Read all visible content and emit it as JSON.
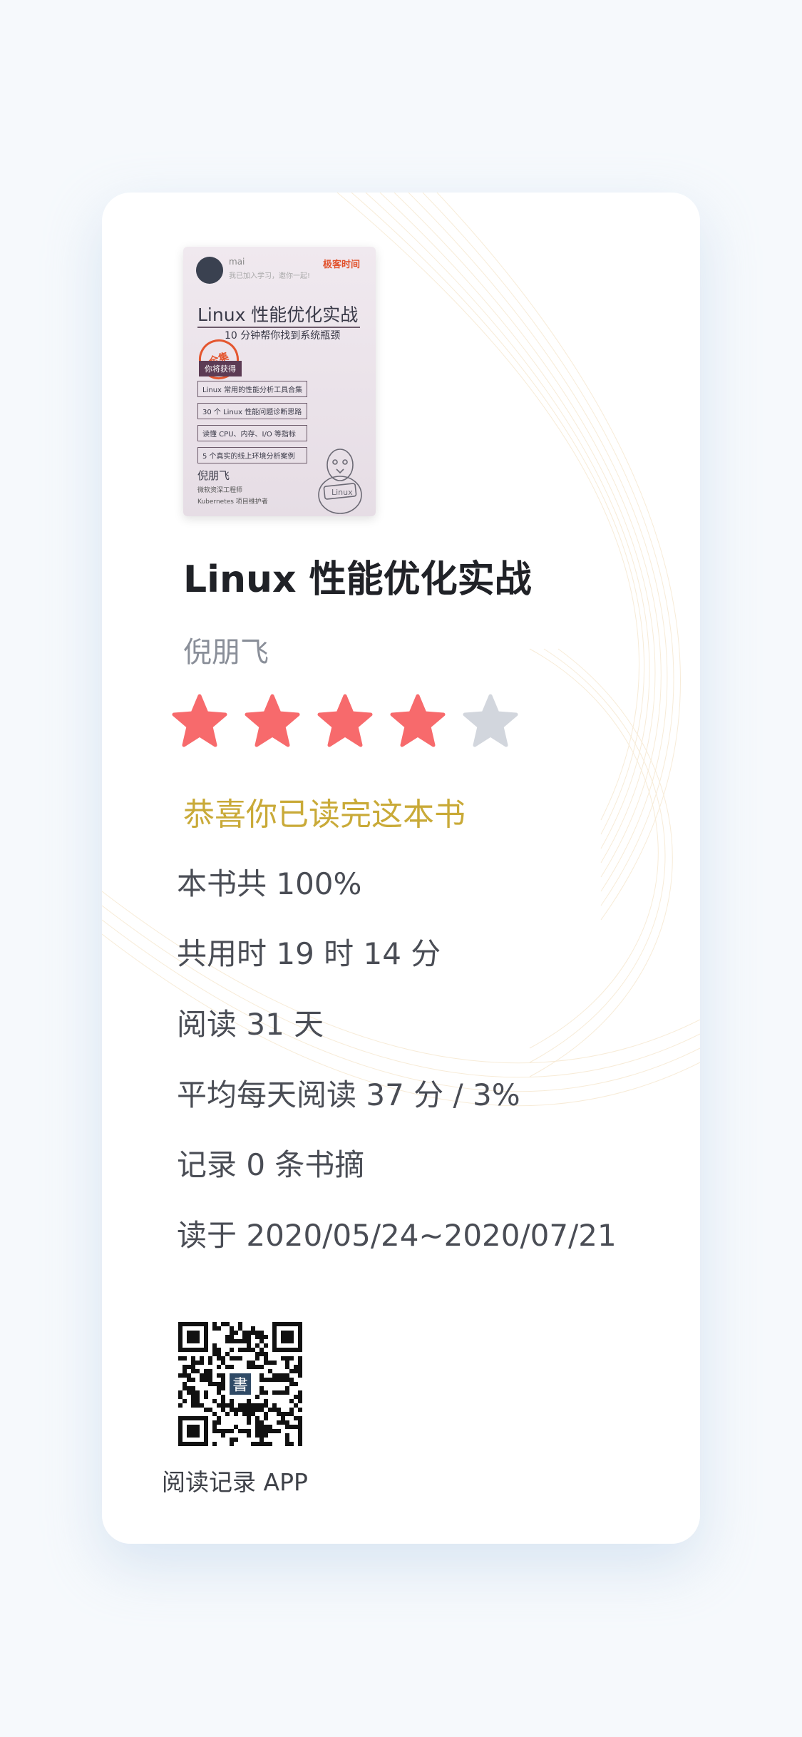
{
  "book": {
    "title": "Linux 性能优化实战",
    "author": "倪朋飞",
    "rating": 4,
    "rating_max": 5
  },
  "cover": {
    "user": "mai",
    "join_text": "我已加入学习，邀你一起!",
    "brand": "极客时间",
    "title": "Linux 性能优化实战",
    "subtitle": "10 分钟帮你找到系统瓶颈",
    "stamp": "全集",
    "gain_label": "你将获得",
    "items": [
      "Linux 常用的性能分析工具合集",
      "30 个 Linux 性能问题诊断思路",
      "读懂 CPU、内存、I/O 等指标",
      "5 个真实的线上环境分析案例"
    ],
    "author": "倪朋飞",
    "role_1": "微软资深工程师",
    "role_2": "Kubernetes 项目维护者",
    "mascot_label": "Linux"
  },
  "congrats": "恭喜你已读完这本书",
  "stats": [
    "本书共 100%",
    "共用时 19 时 14 分",
    "阅读 31 天",
    "平均每天阅读 37 分 / 3%",
    "记录 0 条书摘",
    "读于 2020/05/24~2020/07/21"
  ],
  "qr_badge": "書",
  "app_label": "阅读记录 APP",
  "colors": {
    "star_filled": "#f76a6c",
    "star_empty": "#d2d6dd",
    "congrats": "#c9aa38"
  }
}
